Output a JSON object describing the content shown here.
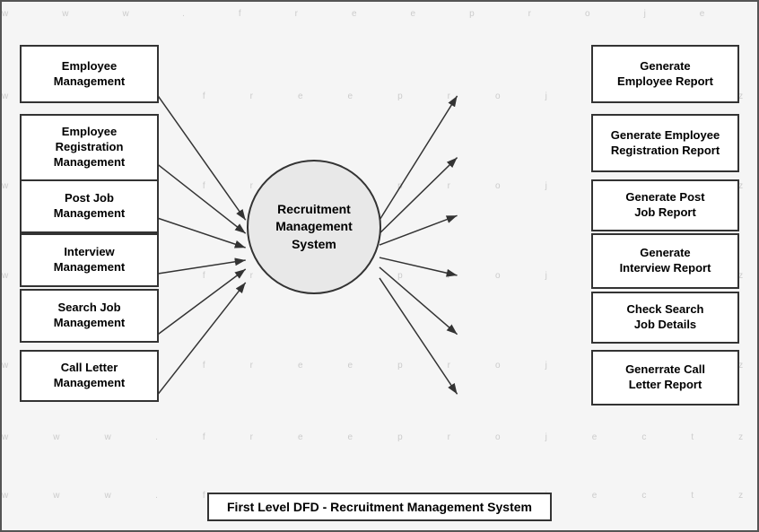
{
  "diagram": {
    "title": "First Level DFD - Recruitment Management System",
    "center": {
      "label": "Recruitment Management System"
    },
    "left_boxes": [
      {
        "id": "lb1",
        "label": "Employee\nManagement"
      },
      {
        "id": "lb2",
        "label": "Employee\nRegistration\nManagement"
      },
      {
        "id": "lb3",
        "label": "Post Job\nManagement"
      },
      {
        "id": "lb4",
        "label": "Interview\nManagement"
      },
      {
        "id": "lb5",
        "label": "Search Job\nManagement"
      },
      {
        "id": "lb6",
        "label": "Call Letter\nManagement"
      }
    ],
    "right_boxes": [
      {
        "id": "rb1",
        "label": "Generate\nEmployee Report"
      },
      {
        "id": "rb2",
        "label": "Generate Employee\nRegistration Report"
      },
      {
        "id": "rb3",
        "label": "Generate Post\nJob Report"
      },
      {
        "id": "rb4",
        "label": "Generate\nInterview Report"
      },
      {
        "id": "rb5",
        "label": "Check Search\nJob Details"
      },
      {
        "id": "rb6",
        "label": "Generrate Call\nLetter Report"
      }
    ],
    "watermarks": [
      "www.freeprojectz.com"
    ]
  }
}
